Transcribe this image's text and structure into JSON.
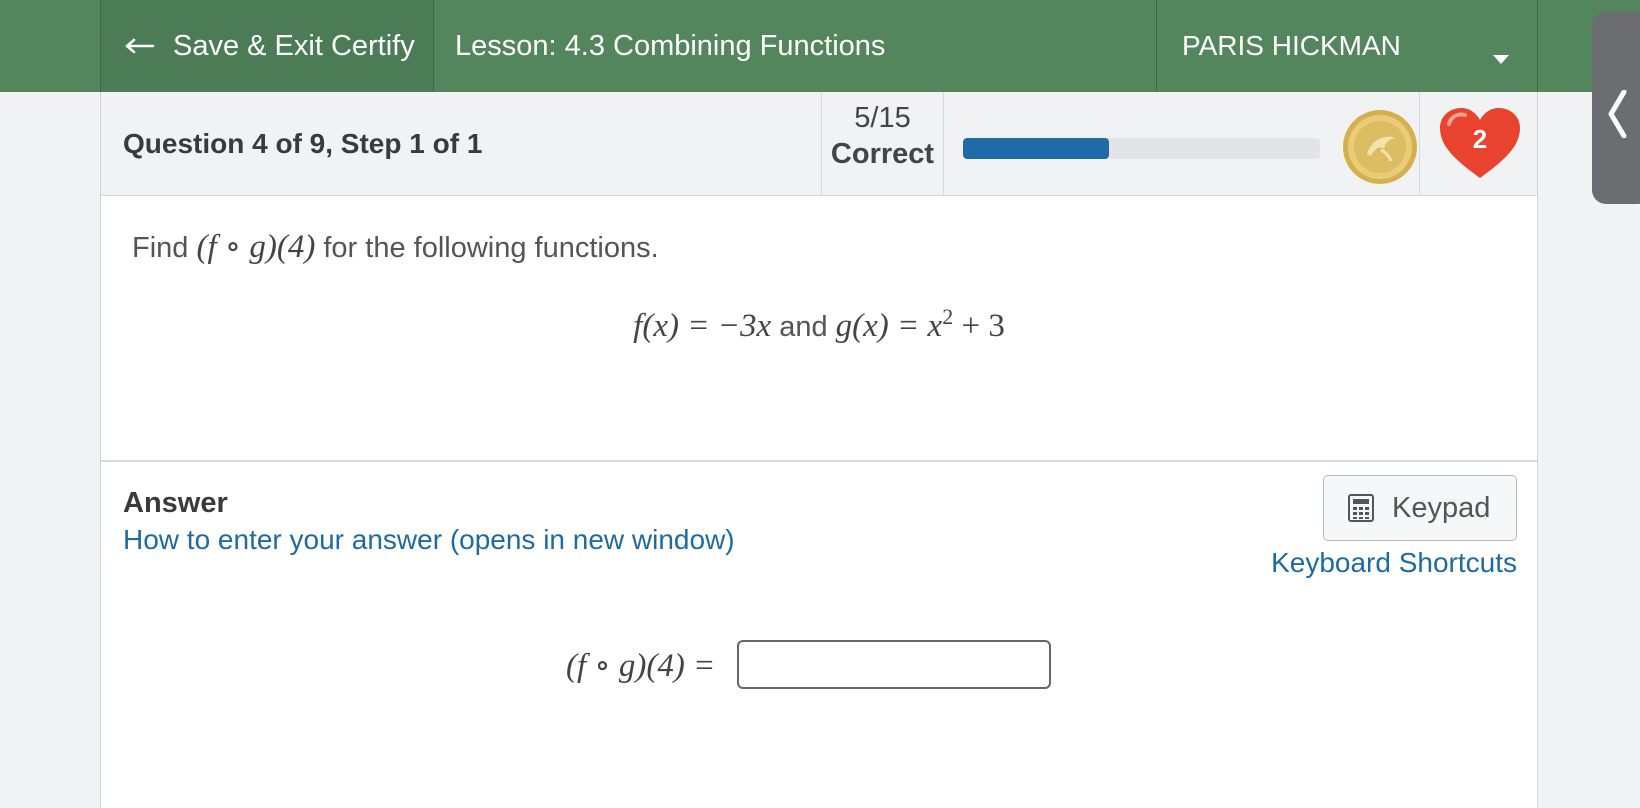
{
  "topbar": {
    "exit_label": "Save & Exit Certify",
    "lesson_title": "Lesson: 4.3 Combining Functions",
    "user_name": "PARIS HICKMAN"
  },
  "status": {
    "question_label": "Question 4 of 9, Step 1 of 1",
    "score_fraction": "5/15",
    "score_label": "Correct",
    "progress_percent": 41,
    "hearts_count": "2"
  },
  "question": {
    "prompt_before": "Find",
    "prompt_expr_lhs": "(f",
    "prompt_expr_op": "∘",
    "prompt_expr_rhs": "g)(4)",
    "prompt_after": "for the following functions.",
    "f_def": "f(x) = −3x",
    "connector": "and",
    "g_def": "g(x) = x",
    "g_exp": "2",
    "g_tail": "+ 3"
  },
  "answer": {
    "label": "Answer",
    "howto_link": "How to enter your answer (opens in new window)",
    "keypad_label": "Keypad",
    "shortcuts_link": "Keyboard Shortcuts",
    "lhs_expr": "(f ∘ g)(4) =",
    "input_value": ""
  },
  "colors": {
    "header_green": "#54865e",
    "progress_blue": "#1f6aaa",
    "link_blue": "#1f6aa3",
    "heart_red": "#e8432f",
    "coin_gold": "#e3c56a"
  },
  "icons": [
    "arrow-left-icon",
    "caret-down-icon",
    "chevron-left-icon",
    "coin-icon",
    "heart-icon",
    "calculator-icon"
  ]
}
